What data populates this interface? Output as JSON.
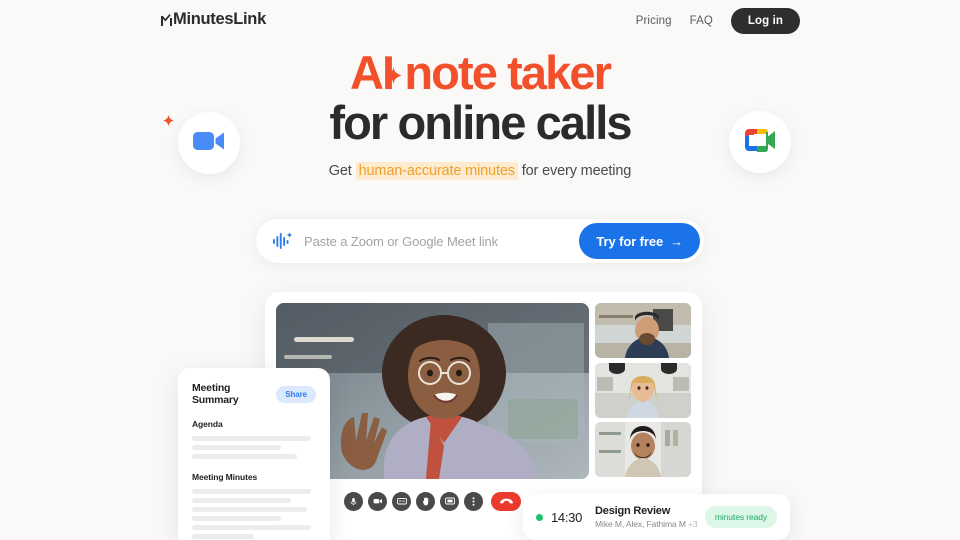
{
  "brand": {
    "name": "MinutesLink",
    "accent_orange": "#F2502B",
    "accent_blue": "#1A73E8",
    "highlight_bg": "#FDEBCF",
    "highlight_text": "#F0A02A",
    "page_bg": "#FAF9F7"
  },
  "nav": {
    "links": [
      {
        "label": "Pricing"
      },
      {
        "label": "FAQ"
      }
    ],
    "login_label": "Log in"
  },
  "hero": {
    "headline_line1": "AI note taker",
    "headline_line2": "for online calls",
    "sub_prefix": "Get ",
    "sub_highlight": "human-accurate minutes",
    "sub_suffix": " for every meeting",
    "bubbles": [
      {
        "name": "zoom-app-icon",
        "label": "Zoom"
      },
      {
        "name": "google-meet-app-icon",
        "label": "Google Meet"
      }
    ]
  },
  "search": {
    "placeholder": "Paste a Zoom or Google Meet link",
    "value": "",
    "cta_label": "Try for free",
    "cta_arrow": "→",
    "icon": "audio-waveform-icon"
  },
  "call": {
    "controls": [
      {
        "name": "microphone-button",
        "label": "Microphone"
      },
      {
        "name": "camera-button",
        "label": "Camera"
      },
      {
        "name": "captions-button",
        "label": "Captions"
      },
      {
        "name": "raise-hand-button",
        "label": "Raise hand"
      },
      {
        "name": "present-screen-button",
        "label": "Present screen"
      },
      {
        "name": "more-options-button",
        "label": "More options"
      }
    ],
    "hangup_label": "Leave call",
    "participants": [
      {
        "name": "participant-thumb-1"
      },
      {
        "name": "participant-thumb-2"
      },
      {
        "name": "participant-thumb-3"
      }
    ]
  },
  "summary": {
    "title": "Meeting Summary",
    "share_label": "Share",
    "sections": [
      {
        "title": "Agenda",
        "lines": [
          96,
          72,
          85
        ]
      },
      {
        "title": "Meeting Minutes",
        "lines": [
          96,
          80,
          93,
          72,
          96,
          50
        ]
      }
    ]
  },
  "notification": {
    "time": "14:30",
    "title": "Design Review",
    "people": "Mike M, Alex, Fathima M",
    "people_extra": "+3",
    "badge": "minutes ready",
    "badge_color": "#22A967"
  }
}
